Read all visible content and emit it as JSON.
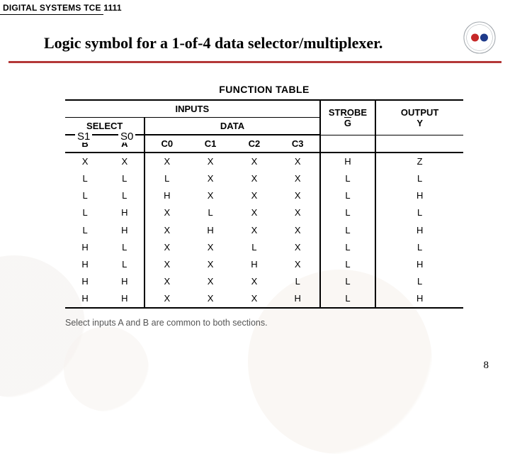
{
  "course_code": "DIGITAL SYSTEMS TCE 1111",
  "slide_title": "Logic symbol for a 1-of-4 data selector/multiplexer.",
  "page_number": "8",
  "table": {
    "title": "FUNCTION TABLE",
    "group_headers": {
      "inputs": "INPUTS",
      "strobe": "STROBE",
      "output": "OUTPUT"
    },
    "sub_headers": {
      "select": "SELECT",
      "data": "DATA",
      "s1": "S1",
      "s0": "S0",
      "c0": "C0",
      "c1": "C1",
      "c2": "C2",
      "c3": "C3",
      "g": "G",
      "y": "Y"
    },
    "rows": [
      [
        "X",
        "X",
        "X",
        "X",
        "X",
        "X",
        "H",
        "Z"
      ],
      [
        "L",
        "L",
        "L",
        "X",
        "X",
        "X",
        "L",
        "L"
      ],
      [
        "L",
        "L",
        "H",
        "X",
        "X",
        "X",
        "L",
        "H"
      ],
      [
        "L",
        "H",
        "X",
        "L",
        "X",
        "X",
        "L",
        "L"
      ],
      [
        "L",
        "H",
        "X",
        "H",
        "X",
        "X",
        "L",
        "H"
      ],
      [
        "H",
        "L",
        "X",
        "X",
        "L",
        "X",
        "L",
        "L"
      ],
      [
        "H",
        "L",
        "X",
        "X",
        "H",
        "X",
        "L",
        "H"
      ],
      [
        "H",
        "H",
        "X",
        "X",
        "X",
        "L",
        "L",
        "L"
      ],
      [
        "H",
        "H",
        "X",
        "X",
        "X",
        "H",
        "L",
        "H"
      ]
    ],
    "footnote": "Select inputs A and B are common to both sections."
  },
  "chart_data": {
    "type": "table",
    "title": "FUNCTION TABLE — 1-of-4 data selector/multiplexer",
    "columns": [
      "S1",
      "S0",
      "C0",
      "C1",
      "C2",
      "C3",
      "STROBE G (active-low)",
      "OUTPUT Y"
    ],
    "rows": [
      [
        "X",
        "X",
        "X",
        "X",
        "X",
        "X",
        "H",
        "Z"
      ],
      [
        "L",
        "L",
        "L",
        "X",
        "X",
        "X",
        "L",
        "L"
      ],
      [
        "L",
        "L",
        "H",
        "X",
        "X",
        "X",
        "L",
        "H"
      ],
      [
        "L",
        "H",
        "X",
        "L",
        "X",
        "X",
        "L",
        "L"
      ],
      [
        "L",
        "H",
        "X",
        "H",
        "X",
        "X",
        "L",
        "H"
      ],
      [
        "H",
        "L",
        "X",
        "X",
        "L",
        "X",
        "L",
        "L"
      ],
      [
        "H",
        "L",
        "X",
        "X",
        "H",
        "X",
        "L",
        "H"
      ],
      [
        "H",
        "H",
        "X",
        "X",
        "X",
        "L",
        "L",
        "L"
      ],
      [
        "H",
        "H",
        "X",
        "X",
        "X",
        "H",
        "L",
        "H"
      ]
    ]
  }
}
